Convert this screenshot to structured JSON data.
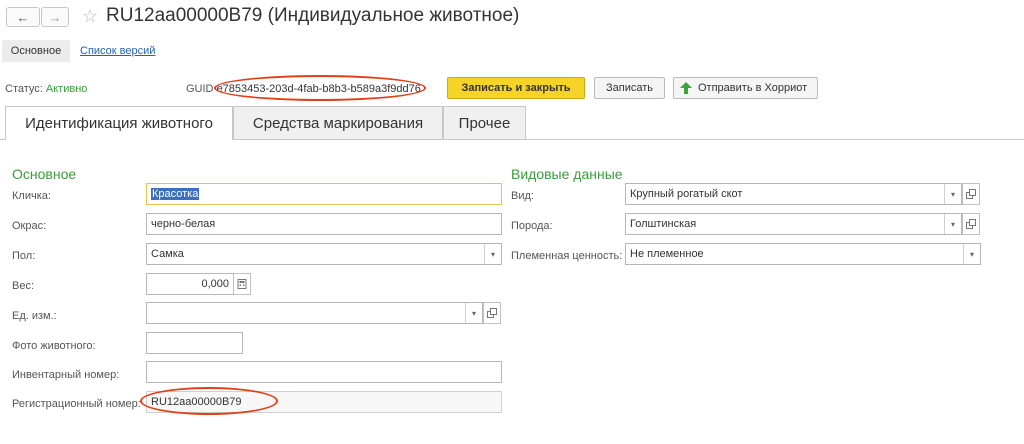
{
  "header": {
    "back_glyph": "←",
    "forward_glyph": "→",
    "star_glyph": "☆",
    "title": "RU12aa00000B79 (Индивидуальное животное)"
  },
  "subnav": {
    "main": "Основное",
    "versions": "Список версий"
  },
  "status": {
    "label": "Статус:",
    "value": "Активно"
  },
  "guid": {
    "label": "GUID",
    "value": "e7853453-203d-4fab-b8b3-b589a3f9dd76"
  },
  "toolbar": {
    "save_close": "Записать и закрыть",
    "save": "Записать",
    "send_label": "Отправить в Хорриот"
  },
  "tabs": [
    "Идентификация животного",
    "Средства маркирования",
    "Прочее"
  ],
  "left_section": {
    "title": "Основное",
    "nickname": {
      "label": "Кличка:",
      "value": "Красотка"
    },
    "color": {
      "label": "Окрас:",
      "value": "черно-белая"
    },
    "sex": {
      "label": "Пол:",
      "value": "Самка"
    },
    "weight": {
      "label": "Вес:",
      "value": "0,000"
    },
    "unit": {
      "label": "Ед. изм.:",
      "value": ""
    },
    "photo": {
      "label": "Фото животного:",
      "value": ""
    },
    "inventory": {
      "label": "Инвентарный номер:",
      "value": ""
    },
    "registration": {
      "label": "Регистрационный номер:",
      "value": "RU12aa00000B79"
    }
  },
  "right_section": {
    "title": "Видовые данные",
    "species": {
      "label": "Вид:",
      "value": "Крупный рогатый скот"
    },
    "breed": {
      "label": "Порода:",
      "value": "Голштинская"
    },
    "pedigree": {
      "label": "Племенная ценность:",
      "value": "Не племенное"
    }
  },
  "colors": {
    "accent_green": "#3a9d3a",
    "primary_button": "#f5d327",
    "annotation_oval": "#e0401a"
  }
}
